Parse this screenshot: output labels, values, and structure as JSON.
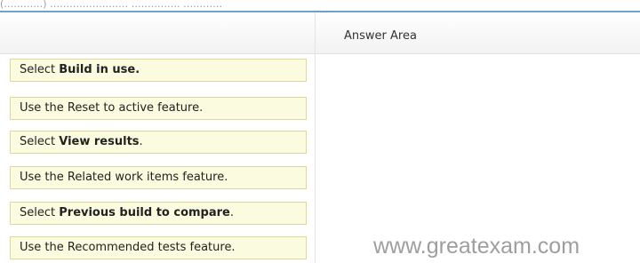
{
  "header": {
    "top_text": "(…………) …………………… …………… …………",
    "grip": "::::::",
    "stray_mark": "."
  },
  "answer_area": {
    "title": "Answer Area"
  },
  "options": [
    {
      "prefix": "Select ",
      "bold": "Build in use.",
      "suffix": ""
    },
    {
      "prefix": "Use the Reset to active feature.",
      "bold": "",
      "suffix": ""
    },
    {
      "prefix": "Select ",
      "bold": "View results",
      "suffix": "."
    },
    {
      "prefix": "Use the Related work items feature.",
      "bold": "",
      "suffix": ""
    },
    {
      "prefix": "Select ",
      "bold": "Previous build to compare",
      "suffix": "."
    },
    {
      "prefix": "Use the Recommended tests feature.",
      "bold": "",
      "suffix": ""
    }
  ],
  "watermark": "www.greatexam.com",
  "colors": {
    "option_fill": "#fbfbdf",
    "option_border": "#e1d79a",
    "top_rule": "#6fa3c8",
    "watermark": "#9e9e9e"
  }
}
